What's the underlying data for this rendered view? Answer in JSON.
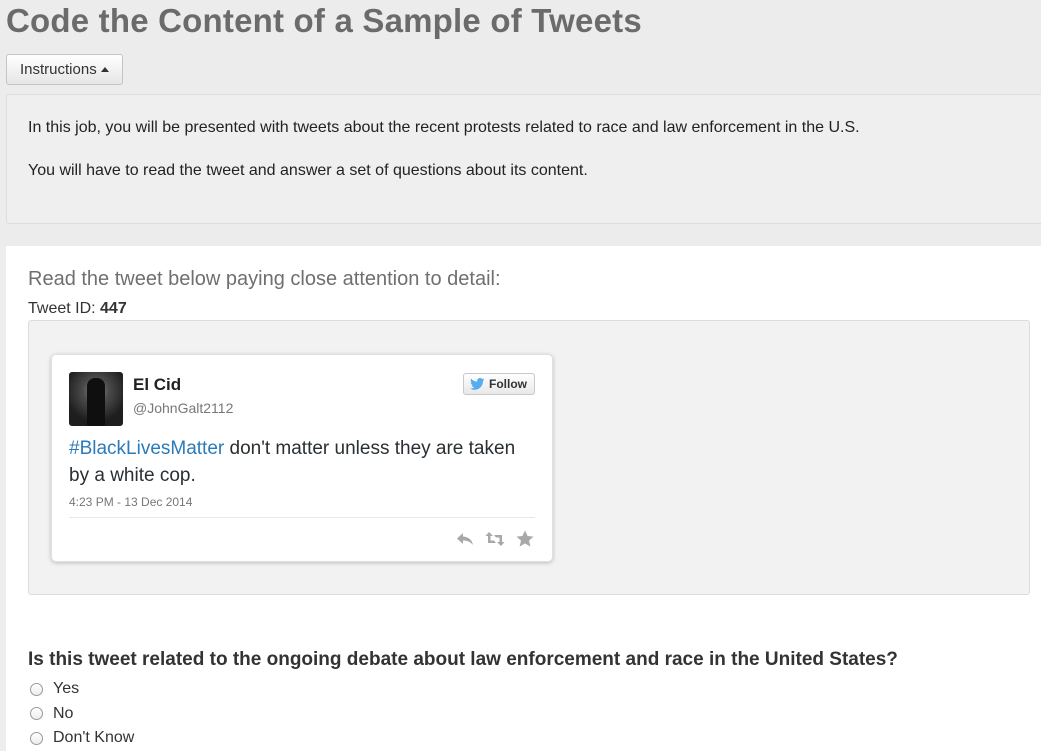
{
  "page": {
    "title": "Code the Content of a Sample of Tweets"
  },
  "instructions": {
    "button_label": "Instructions",
    "lines": [
      "In this job, you will be presented with tweets about the recent protests related to race and law enforcement in the U.S.",
      "You will have to read the tweet and answer a set of questions about its content."
    ]
  },
  "task": {
    "heading": "Read the tweet below paying close attention to detail:",
    "tweet_id_label": "Tweet ID:",
    "tweet_id_value": "447"
  },
  "tweet": {
    "user_name": "El Cid",
    "user_handle": "@JohnGalt2112",
    "follow_label": "Follow",
    "hashtag": "#BlackLivesMatter",
    "text_rest": " don't matter unless they are taken by a white cop.",
    "timestamp": "4:23 PM - 13 Dec 2014",
    "actions": [
      "reply-icon",
      "retweet-icon",
      "favorite-icon"
    ]
  },
  "question": {
    "text": "Is this tweet related to the ongoing debate about law enforcement and race in the United States?",
    "options": [
      "Yes",
      "No",
      "Don't Know"
    ]
  },
  "colors": {
    "hashtag": "#2b7bb9",
    "title": "#6b6b6b",
    "twitter_blue": "#55acee"
  }
}
